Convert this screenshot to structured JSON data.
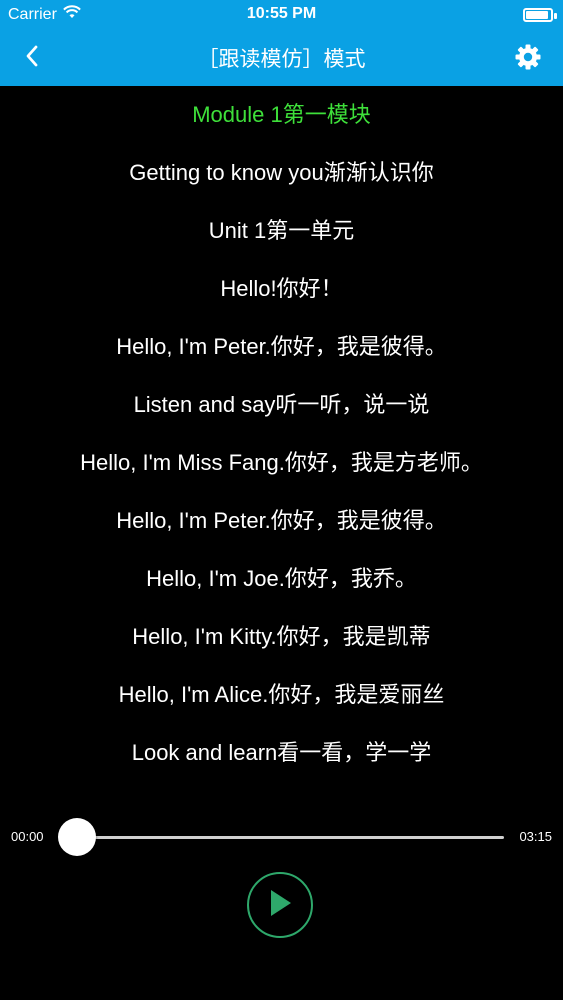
{
  "status_bar": {
    "carrier": "Carrier",
    "time": "10:55 PM",
    "battery_level": 1.0
  },
  "nav": {
    "title": "［跟读模仿］模式",
    "back_icon": "chevron-left-icon",
    "settings_icon": "gear-icon"
  },
  "lines": [
    "Module 1第一模块",
    "Getting to know you渐渐认识你",
    "Unit 1第一单元",
    "Hello!你好！",
    "Hello, I'm Peter.你好，我是彼得。",
    "Listen and say听一听，说一说",
    "Hello, I'm Miss Fang.你好，我是方老师。",
    "Hello, I'm Peter.你好，我是彼得。",
    "Hello, I'm Joe.你好，我乔。",
    "Hello, I'm Kitty.你好，我是凯蒂",
    "Hello, I'm Alice.你好，我是爱丽丝",
    "Look and learn看一看，学一学"
  ],
  "active_line": 0,
  "player": {
    "current_time": "00:00",
    "duration": "03:15",
    "progress": 0.0,
    "play_icon": "play-icon"
  },
  "colors": {
    "accent": "#0aa1e4",
    "highlight": "#3ee03a",
    "play_ring": "#2ea86b"
  }
}
